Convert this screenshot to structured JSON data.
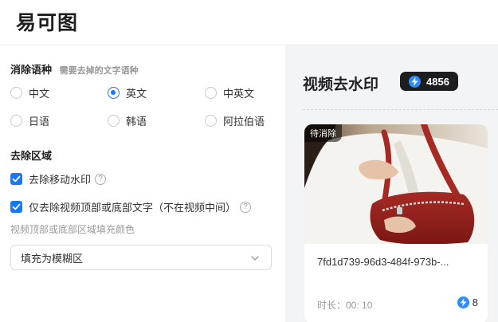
{
  "brand": {
    "logo_text": "易可图"
  },
  "language_section": {
    "title": "消除语种",
    "hint": "需要去掉的文字语种",
    "options": [
      "中文",
      "英文",
      "中英文",
      "日语",
      "韩语",
      "阿拉伯语"
    ],
    "selected": "英文"
  },
  "area_section": {
    "title": "去除区域",
    "checkbox_remove_moving": "去除移动水印",
    "checkbox_top_bottom": "仅去除视频顶部或底部文字（不在视频中间）",
    "fill_label": "视频顶部或底部区域填充颜色",
    "fill_select_value": "填充为模糊区",
    "help_glyph": "?"
  },
  "panel": {
    "title": "视频去水印",
    "points": "4856"
  },
  "task_card": {
    "status_tag": "待消除",
    "filename": "7fd1d739-96d3-484f-973b-...",
    "duration": "时长：00: 10",
    "cost": "8"
  },
  "colors": {
    "accent": "#1677ff",
    "bolt": "#2b8cff",
    "badge_bg": "#1d1d1f",
    "panel_bg": "#f3f4f6"
  },
  "icons": [
    "radio-icon",
    "checkbox-checked-icon",
    "help-icon",
    "chevron-down-icon",
    "lightning-icon"
  ]
}
